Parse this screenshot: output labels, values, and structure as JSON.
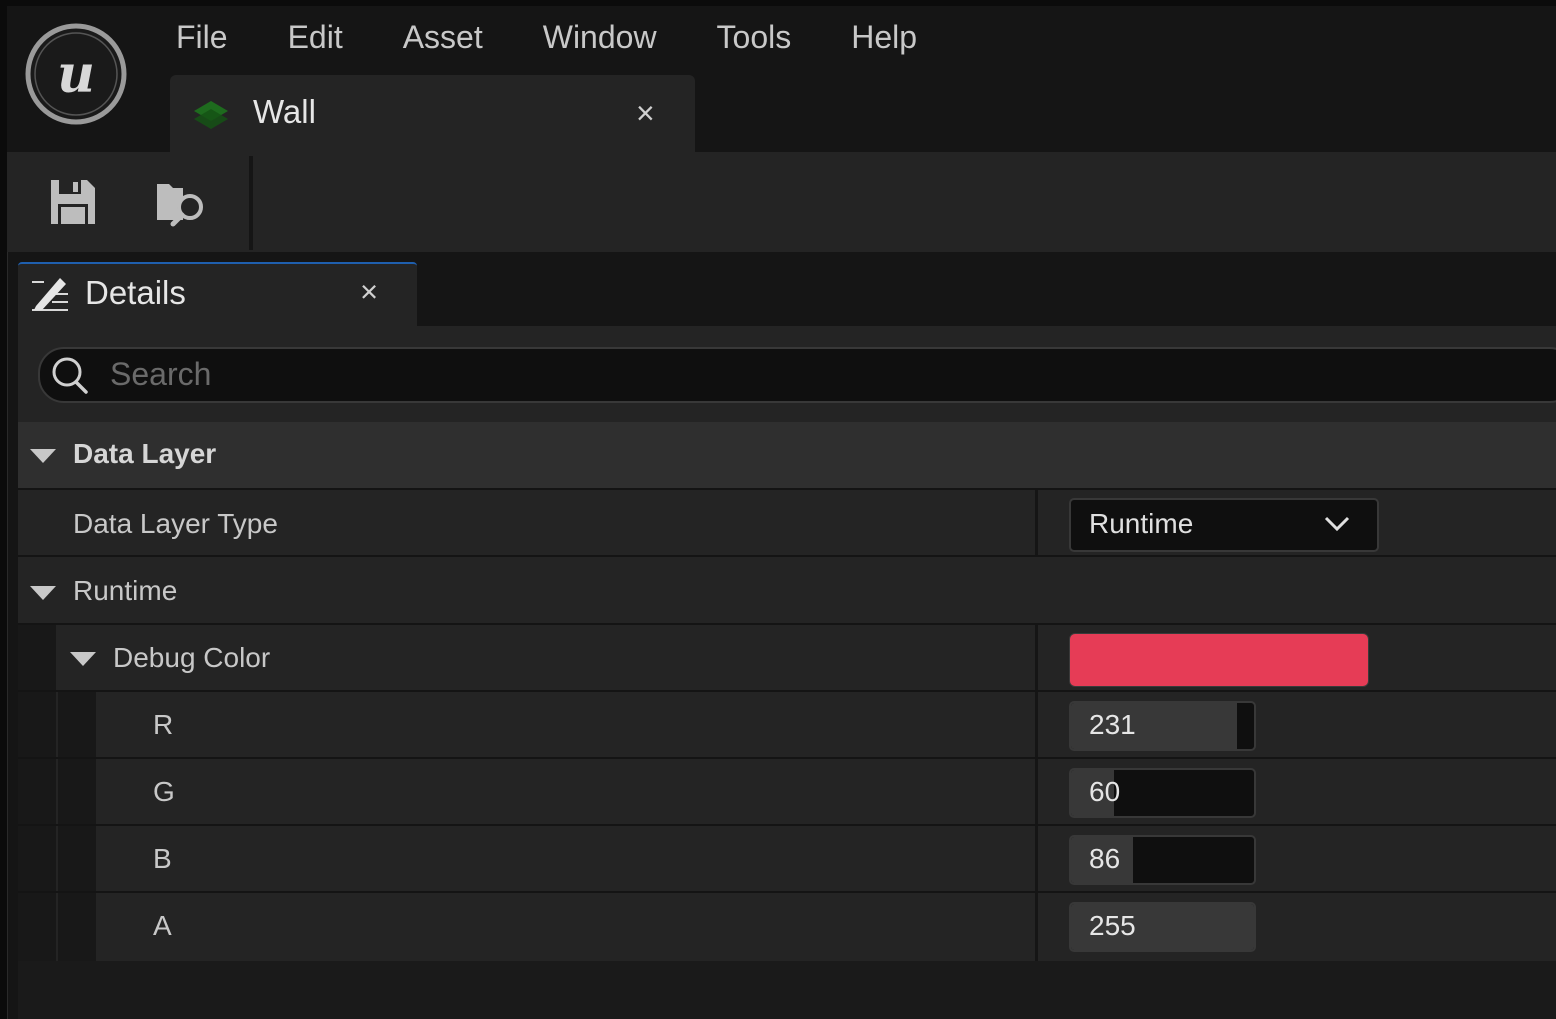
{
  "menu": [
    "File",
    "Edit",
    "Asset",
    "Window",
    "Tools",
    "Help"
  ],
  "document_tab": {
    "label": "Wall",
    "close": "×"
  },
  "details_tab": {
    "label": "Details",
    "close": "×"
  },
  "search": {
    "placeholder": "Search",
    "value": ""
  },
  "category": {
    "label": "Data Layer"
  },
  "data_layer_type": {
    "label": "Data Layer Type",
    "value": "Runtime"
  },
  "runtime_group": {
    "label": "Runtime"
  },
  "debug_color": {
    "label": "Debug Color",
    "swatch_color": "#e63c56",
    "channels": [
      {
        "name": "R",
        "value": "231",
        "fill": 0.906
      },
      {
        "name": "G",
        "value": "60",
        "fill": 0.235
      },
      {
        "name": "B",
        "value": "86",
        "fill": 0.337
      },
      {
        "name": "A",
        "value": "255",
        "fill": 1.0
      }
    ]
  },
  "colors": {
    "accent_tab": "#1f5fae",
    "tab_icon": "#1e6b1e"
  }
}
